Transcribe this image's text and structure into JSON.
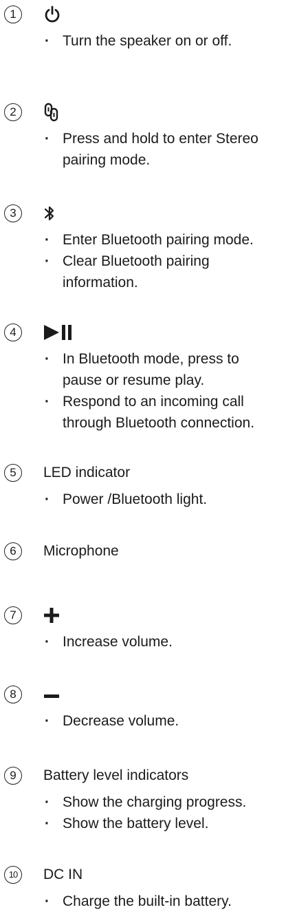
{
  "items": [
    {
      "num": "1",
      "icon": "power-icon",
      "bullets": [
        "Turn the speaker on or off."
      ]
    },
    {
      "num": "2",
      "icon": "stereo-link-icon",
      "bullets": [
        "Press and hold to enter Stereo",
        "pairing mode."
      ]
    },
    {
      "num": "3",
      "icon": "bluetooth-icon",
      "bullets": [
        "Enter Bluetooth pairing mode.",
        "Clear Bluetooth pairing",
        "information."
      ]
    },
    {
      "num": "4",
      "icon": "play-pause-icon",
      "bullets": [
        "In Bluetooth mode, press to",
        "pause or resume play.",
        "Respond to an incoming call",
        "through Bluetooth connection."
      ]
    },
    {
      "num": "5",
      "title": "LED indicator",
      "bullets": [
        "Power /Bluetooth light."
      ]
    },
    {
      "num": "6",
      "title": "Microphone"
    },
    {
      "num": "7",
      "icon": "plus-icon",
      "bullets": [
        "Increase volume."
      ]
    },
    {
      "num": "8",
      "icon": "minus-icon",
      "bullets": [
        "Decrease volume."
      ]
    },
    {
      "num": "9",
      "title": "Battery level indicators",
      "bullets": [
        "Show the charging progress.",
        "Show the battery level."
      ]
    },
    {
      "num": "10",
      "title": "DC IN",
      "bullets": [
        "Charge the built-in battery."
      ]
    }
  ]
}
